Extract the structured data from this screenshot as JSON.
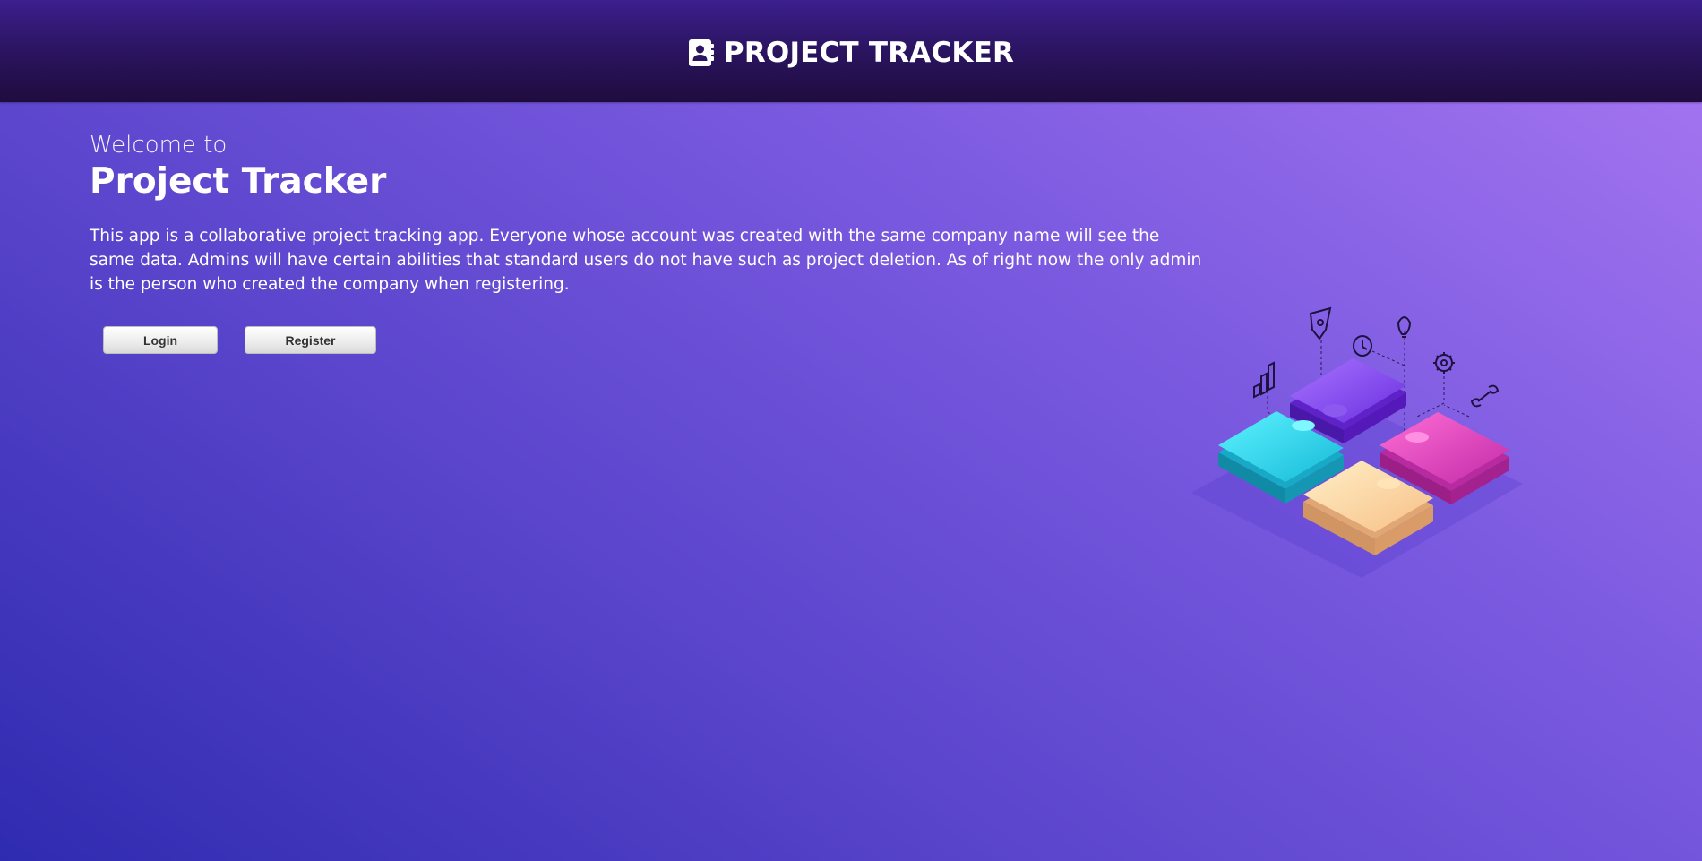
{
  "header": {
    "brand_name": "PROJECT TRACKER",
    "brand_icon": "contact-book-icon"
  },
  "hero": {
    "welcome": "Welcome to",
    "title": "Project Tracker",
    "description": "This app is a collaborative project tracking app. Everyone whose account was created with the same company name will see the same data. Admins will have certain abilities that standard users do not have such as project deletion. As of right now the only admin is the person who created the company when registering."
  },
  "actions": {
    "login_label": "Login",
    "register_label": "Register"
  },
  "illustration": {
    "name": "puzzle-pieces-illustration",
    "icons": [
      "bar-chart-icon",
      "shield-icon",
      "clock-icon",
      "lightbulb-icon",
      "gear-icon",
      "wrench-icon"
    ]
  },
  "colors": {
    "header_bg": "#2b1460",
    "bg_start": "#2f2bb0",
    "bg_end": "#a877f2",
    "puzzle_purple": "#8a4cf0",
    "puzzle_cyan": "#28d7ea",
    "puzzle_pink": "#e93fc0",
    "puzzle_peach": "#ffd5a0"
  }
}
